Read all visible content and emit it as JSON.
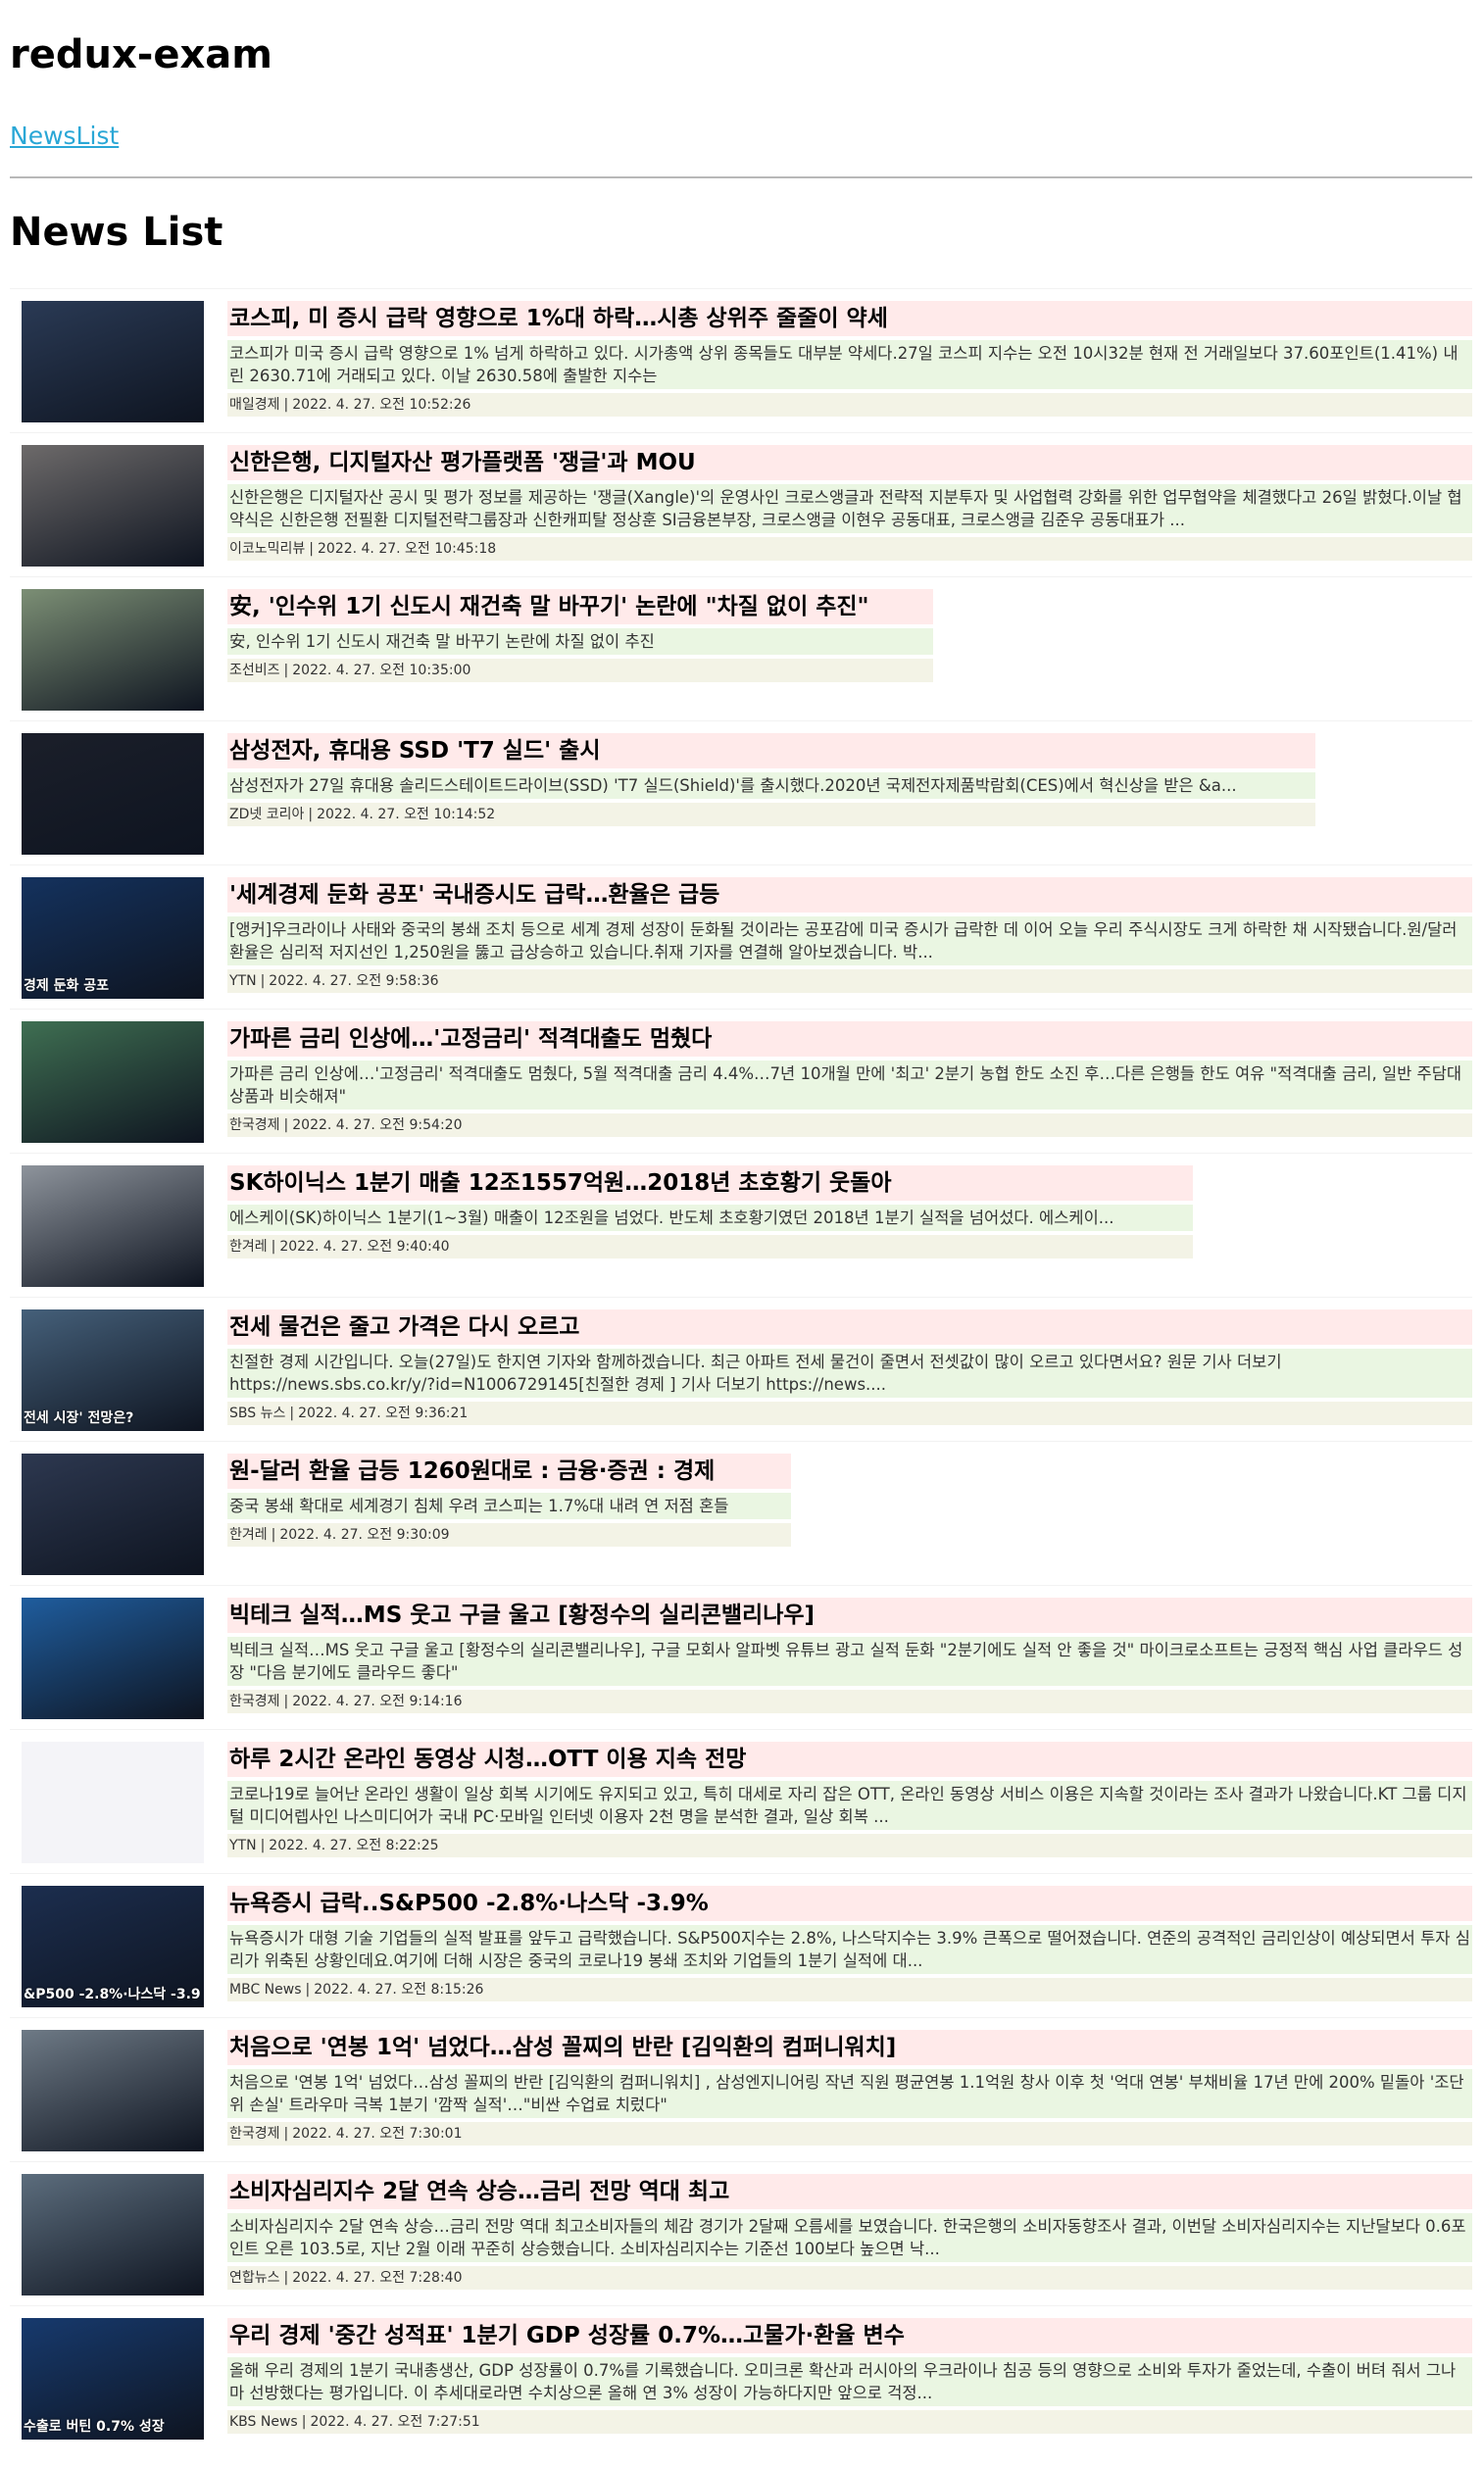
{
  "app": {
    "title": "redux-exam"
  },
  "nav": {
    "link_label": "NewsList"
  },
  "page": {
    "heading": "News List"
  },
  "news": [
    {
      "title": "코스피, 미 증시 급락 영향으로 1%대 하락…시총 상위주 줄줄이 약세",
      "desc": "코스피가 미국 증시 급락 영향으로 1% 넘게 하락하고 있다. 시가총액 상위 종목들도 대부분 약세다.27일 코스피 지수는 오전 10시32분 현재 전 거래일보다 37.60포인트(1.41%) 내린 2630.71에 거래되고 있다. 이날 2630.58에 출발한 지수는",
      "source": "매일경제",
      "date": "2022. 4. 27. 오전 10:52:26",
      "thumb_caption": "",
      "thumb_color": "#2a3a55"
    },
    {
      "title": "신한은행, 디지털자산 평가플랫폼 '쟁글'과 MOU",
      "desc": "신한은행은 디지털자산 공시 및 평가 정보를 제공하는 '쟁글(Xangle)'의 운영사인 크로스앵글과 전략적 지분투자 및 사업협력 강화를 위한 업무협약을 체결했다고 26일 밝혔다.이날 협약식은 신한은행 전필환 디지털전략그룹장과 신한캐피탈 정상훈 SI금융본부장, 크로스앵글 이현우 공동대표, 크로스앵글 김준우 공동대표가 ...",
      "source": "이코노믹리뷰",
      "date": "2022. 4. 27. 오전 10:45:18",
      "thumb_caption": "",
      "thumb_color": "#6d6a6a"
    },
    {
      "title": "安, '인수위 1기 신도시 재건축 말 바꾸기' 논란에 \"차질 없이 추진\"",
      "desc": "安, 인수위 1기 신도시 재건축 말 바꾸기 논란에 차질 없이 추진",
      "source": "조선비즈",
      "date": "2022. 4. 27. 오전 10:35:00",
      "thumb_caption": "",
      "thumb_color": "#7c8f75"
    },
    {
      "title": "삼성전자, 휴대용 SSD 'T7 실드' 출시",
      "desc": "삼성전자가 27일 휴대용 솔리드스테이트드라이브(SSD) 'T7 실드(Shield)'를 출시했다.2020년 국제전자제품박람회(CES)에서 혁신상을 받은 &a...",
      "source": "ZD넷 코리아",
      "date": "2022. 4. 27. 오전 10:14:52",
      "thumb_caption": "",
      "thumb_color": "#1b1f2a"
    },
    {
      "title": "'세계경제 둔화 공포' 국내증시도 급락…환율은 급등",
      "desc": "[앵커]우크라이나 사태와 중국의 봉쇄 조치 등으로 세계 경제 성장이 둔화될 것이라는 공포감에 미국 증시가 급락한 데 이어 오늘 우리 주식시장도 크게 하락한 채 시작됐습니다.원/달러 환율은 심리적 저지선인 1,250원을 뚫고 급상승하고 있습니다.취재 기자를 연결해 알아보겠습니다. 박...",
      "source": "YTN",
      "date": "2022. 4. 27. 오전 9:58:36",
      "thumb_caption": "경제 둔화 공포",
      "thumb_color": "#14325e"
    },
    {
      "title": "가파른 금리 인상에…'고정금리' 적격대출도 멈췄다",
      "desc": "가파른 금리 인상에…'고정금리' 적격대출도 멈췄다, 5월 적격대출 금리 4.4%…7년 10개월 만에 '최고' 2분기 농협 한도 소진 후…다른 은행들 한도 여유 \"적격대출 금리, 일반 주담대 상품과 비슷해져\"",
      "source": "한국경제",
      "date": "2022. 4. 27. 오전 9:54:20",
      "thumb_caption": "",
      "thumb_color": "#3f6f52"
    },
    {
      "title": "SK하이닉스 1분기 매출 12조1557억원…2018년 초호황기 웃돌아",
      "desc": "에스케이(SK)하이닉스 1분기(1~3월) 매출이 12조원을 넘었다. 반도체 초호황기였던 2018년 1분기 실적을 넘어섰다. 에스케이...",
      "source": "한겨레",
      "date": "2022. 4. 27. 오전 9:40:40",
      "thumb_caption": "",
      "thumb_color": "#8e949c"
    },
    {
      "title": "전세 물건은 줄고 가격은 다시 오르고",
      "desc": "친절한 경제 시간입니다. 오늘(27일)도 한지연 기자와 함께하겠습니다. 최근 아파트 전세 물건이 줄면서 전셋값이 많이 오르고 있다면서요? 원문 기사 더보기 https://news.sbs.co.kr/y/?id=N1006729145[친절한 경제 ] 기사 더보기 https://news....",
      "source": "SBS 뉴스",
      "date": "2022. 4. 27. 오전 9:36:21",
      "thumb_caption": "전세 시장' 전망은?",
      "thumb_color": "#45607a"
    },
    {
      "title": "원-달러 환율 급등 1260원대로 : 금융·증권 : 경제",
      "desc": "중국 봉쇄 확대로 세계경기 침체 우려 코스피는 1.7%대 내려 연 저점 혼들",
      "source": "한겨레",
      "date": "2022. 4. 27. 오전 9:30:09",
      "thumb_caption": "",
      "thumb_color": "#2d3850"
    },
    {
      "title": "빅테크 실적…MS 웃고 구글 울고 [황정수의 실리콘밸리나우]",
      "desc": "빅테크 실적…MS 웃고 구글 울고 [황정수의 실리콘밸리나우], 구글 모회사 알파벳 유튜브 광고 실적 둔화 \"2분기에도 실적 안 좋을 것\" 마이크로소프트는 긍정적 핵심 사업 클라우드 성장 \"다음 분기에도 클라우드 좋다\"",
      "source": "한국경제",
      "date": "2022. 4. 27. 오전 9:14:16",
      "thumb_caption": "",
      "thumb_color": "#1f5d9e"
    },
    {
      "title": "하루 2시간 온라인 동영상 시청…OTT 이용 지속 전망",
      "desc": "코로나19로 늘어난 온라인 생활이 일상 회복 시기에도 유지되고 있고, 특히 대세로 자리 잡은 OTT, 온라인 동영상 서비스 이용은 지속할 것이라는 조사 결과가 나왔습니다.KT 그룹 디지털 미디어렙사인 나스미디어가 국내 PC·모바일 인터넷 이용자 2천 명을 분석한 결과, 일상 회복 ...",
      "source": "YTN",
      "date": "2022. 4. 27. 오전 8:22:25",
      "thumb_caption": "",
      "thumb_color": "#f4f4f8"
    },
    {
      "title": "뉴욕증시 급락..S&P500 -2.8%·나스닥 -3.9%",
      "desc": "뉴욕증시가 대형 기술 기업들의 실적 발표를 앞두고 급락했습니다. S&P500지수는 2.8%, 나스닥지수는 3.9% 큰폭으로 떨어졌습니다. 연준의 공격적인 금리인상이 예상되면서 투자 심리가 위축된 상황인데요.여기에 더해 시장은 중국의 코로나19 봉쇄 조치와 기업들의 1분기 실적에 대...",
      "source": "MBC News",
      "date": "2022. 4. 27. 오전 8:15:26",
      "thumb_caption": "&P500 -2.8%·나스닥 -3.9",
      "thumb_color": "#1c2e4f"
    },
    {
      "title": "처음으로 '연봉 1억' 넘었다…삼성 꼴찌의 반란 [김익환의 컴퍼니워치]",
      "desc": "처음으로 '연봉 1억' 넘었다…삼성 꼴찌의 반란 [김익환의 컴퍼니워치] , 삼성엔지니어링 작년 직원 평균연봉 1.1억원 창사 이후 첫 '억대 연봉' 부채비율 17년 만에 200% 밑돌아 '조단위 손실' 트라우마 극복 1분기 '깜짝 실적'…\"비싼 수업료 치렀다\"",
      "source": "한국경제",
      "date": "2022. 4. 27. 오전 7:30:01",
      "thumb_caption": "",
      "thumb_color": "#6e7a86"
    },
    {
      "title": "소비자심리지수 2달 연속 상승…금리 전망 역대 최고",
      "desc": "소비자심리지수 2달 연속 상승…금리 전망 역대 최고소비자들의 체감 경기가 2달째 오름세를 보였습니다. 한국은행의 소비자동향조사 결과, 이번달 소비자심리지수는 지난달보다 0.6포인트 오른 103.5로, 지난 2월 이래 꾸준히 상승했습니다. 소비자심리지수는 기준선 100보다 높으면 낙...",
      "source": "연합뉴스",
      "date": "2022. 4. 27. 오전 7:28:40",
      "thumb_caption": "",
      "thumb_color": "#5c6d7d"
    },
    {
      "title": "우리 경제 '중간 성적표' 1분기 GDP 성장률 0.7%…고물가·환율 변수",
      "desc": "올해 우리 경제의 1분기 국내총생산, GDP 성장률이 0.7%를 기록했습니다. 오미크론 확산과 러시아의 우크라이나 침공 등의 영향으로 소비와 투자가 줄었는데, 수출이 버텨 줘서 그나마 선방했다는 평가입니다. 이 추세대로라면 수치상으론 올해 연 3% 성장이 가능하다지만 앞으로 걱정...",
      "source": "KBS News",
      "date": "2022. 4. 27. 오전 7:27:51",
      "thumb_caption": "수출로 버틴 0.7% 성장",
      "thumb_color": "#173a6e"
    }
  ]
}
